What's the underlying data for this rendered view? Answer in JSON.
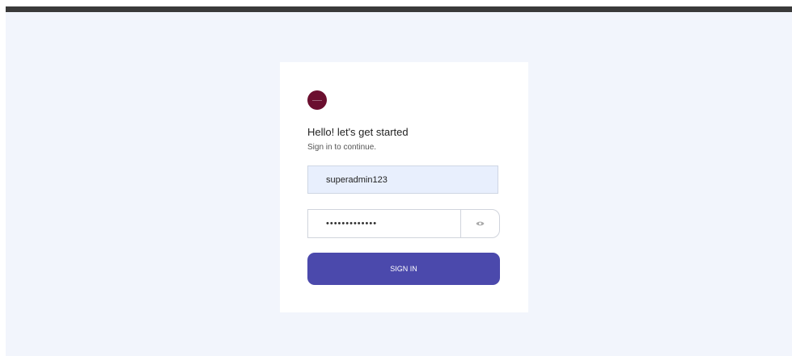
{
  "login": {
    "heading": "Hello! let's get started",
    "subheading": "Sign in to continue.",
    "username_value": "superadmin123",
    "password_value": "•••••••••••••",
    "show_password_icon": "eye-icon",
    "sign_in_label": "SIGN IN"
  },
  "colors": {
    "top_bar": "#3a3a3a",
    "page_background": "#f2f5fc",
    "card_background": "#ffffff",
    "logo": "#6b0f2f",
    "username_field_background": "#e8effd",
    "primary_button": "#4b49ac"
  }
}
